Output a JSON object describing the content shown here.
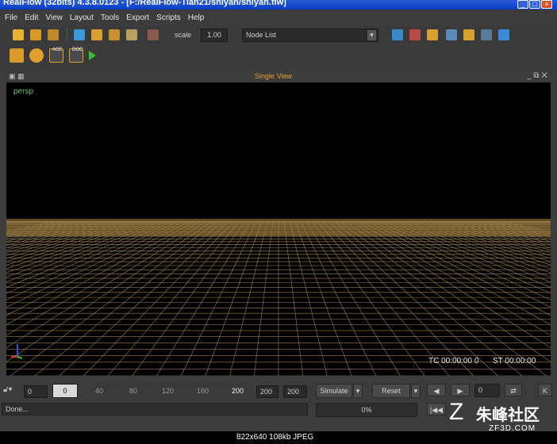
{
  "window": {
    "title": "RealFlow (32bits) 4.3.8.0123 - [F:/RealFlow-Tian21/shiyan/shiyan.flw]"
  },
  "menu": [
    "File",
    "Edit",
    "View",
    "Layout",
    "Tools",
    "Export",
    "Scripts",
    "Help"
  ],
  "toolbar": {
    "scale_label": "scale",
    "scale_value": "1.00",
    "node_list": "Node List"
  },
  "toolbar2": {
    "icon_labels": [
      "AGE",
      "DOC"
    ]
  },
  "viewport": {
    "title": "Single View",
    "camera": "persp",
    "timecode": "TC 00:00:00 0",
    "st": "ST 00:00:00",
    "floor_color": "#b48a3c",
    "grid_color": "#9a8050"
  },
  "timeline": {
    "start": "0",
    "current": "0",
    "ticks": [
      "40",
      "80",
      "120",
      "160",
      "200"
    ],
    "end": "200",
    "end2": "200",
    "simulate_label": "Simulate",
    "reset_label": "Reset",
    "frame": "0",
    "key_label": "K"
  },
  "status": {
    "text": "Done...",
    "progress": "0%"
  },
  "image_info": "822x640  108kb  JPEG",
  "watermark": {
    "main": "朱峰社区",
    "sub": "ZF3D.COM"
  }
}
